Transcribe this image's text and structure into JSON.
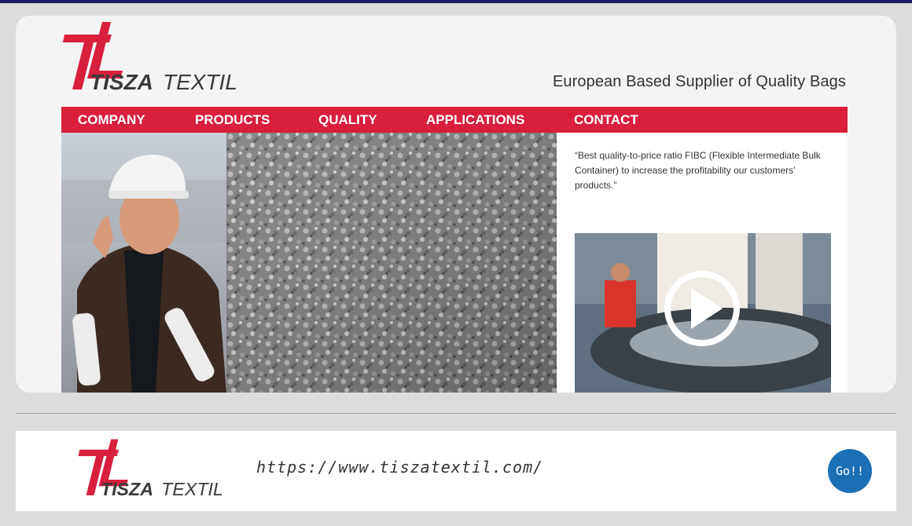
{
  "header": {
    "logo": {
      "word_bold": "TISZA",
      "word_light": "TEXTIL",
      "mark": "TL"
    },
    "tagline": "European Based Supplier of Quality Bags"
  },
  "nav": {
    "items": [
      {
        "label": "COMPANY"
      },
      {
        "label": "PRODUCTS"
      },
      {
        "label": "QUALITY"
      },
      {
        "label": "APPLICATIONS"
      },
      {
        "label": "CONTACT"
      }
    ]
  },
  "main": {
    "quote": "“Best quality-to-price ratio FIBC (Flexible Intermediate Bulk Container) to increase the profitability our customers’ products.”",
    "video": {
      "icon": "play-icon"
    }
  },
  "footer": {
    "url": "https://www.tiszatextil.com/",
    "go_label": "Go!!"
  },
  "colors": {
    "accent": "#d81f3c",
    "topbar": "#1c1760",
    "go_button": "#1a6fb5"
  }
}
